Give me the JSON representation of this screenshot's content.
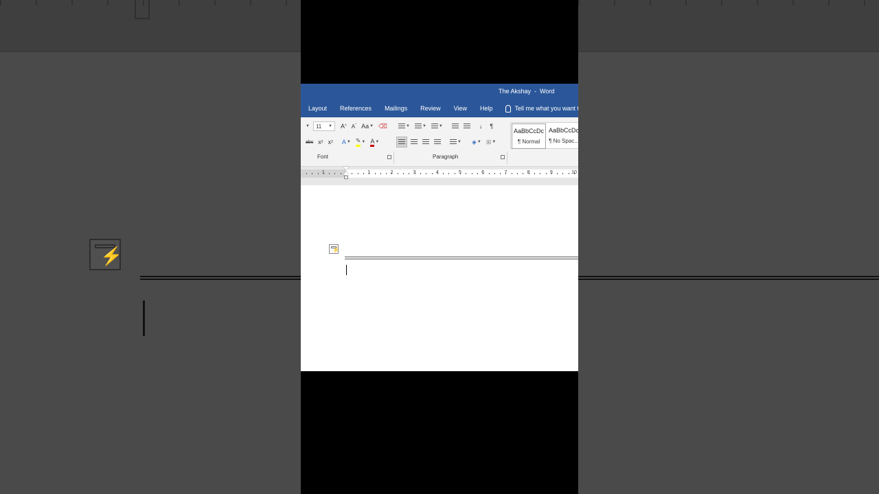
{
  "window": {
    "title": "The Akshay  -  Word"
  },
  "tabs": [
    "Layout",
    "References",
    "Mailings",
    "Review",
    "View",
    "Help"
  ],
  "tell_me": "Tell me what you want to",
  "font": {
    "size": "11",
    "group_label": "Font"
  },
  "paragraph": {
    "group_label": "Paragraph"
  },
  "styles": [
    {
      "preview": "AaBbCcDc",
      "name": "¶ Normal"
    },
    {
      "preview": "AaBbCcDc",
      "name": "¶ No Spac..."
    }
  ],
  "ruler": {
    "numbers": [
      "1",
      "1",
      "2",
      "3",
      "4",
      "5",
      "6",
      "7",
      "8",
      "9",
      "10"
    ]
  },
  "glyphs": {
    "grow": "A",
    "shrink": "A",
    "change_case": "Aa",
    "strike": "abc",
    "sub": "x",
    "sup": "x",
    "pilcrow": "¶",
    "sort": "↓",
    "font_color": "A",
    "text_effects": "A"
  },
  "colors": {
    "title_bar": "#2b579a",
    "ribbon": "#f3f3f3",
    "font_color_bar": "#c00000",
    "highlight_bar": "#ffff00"
  }
}
